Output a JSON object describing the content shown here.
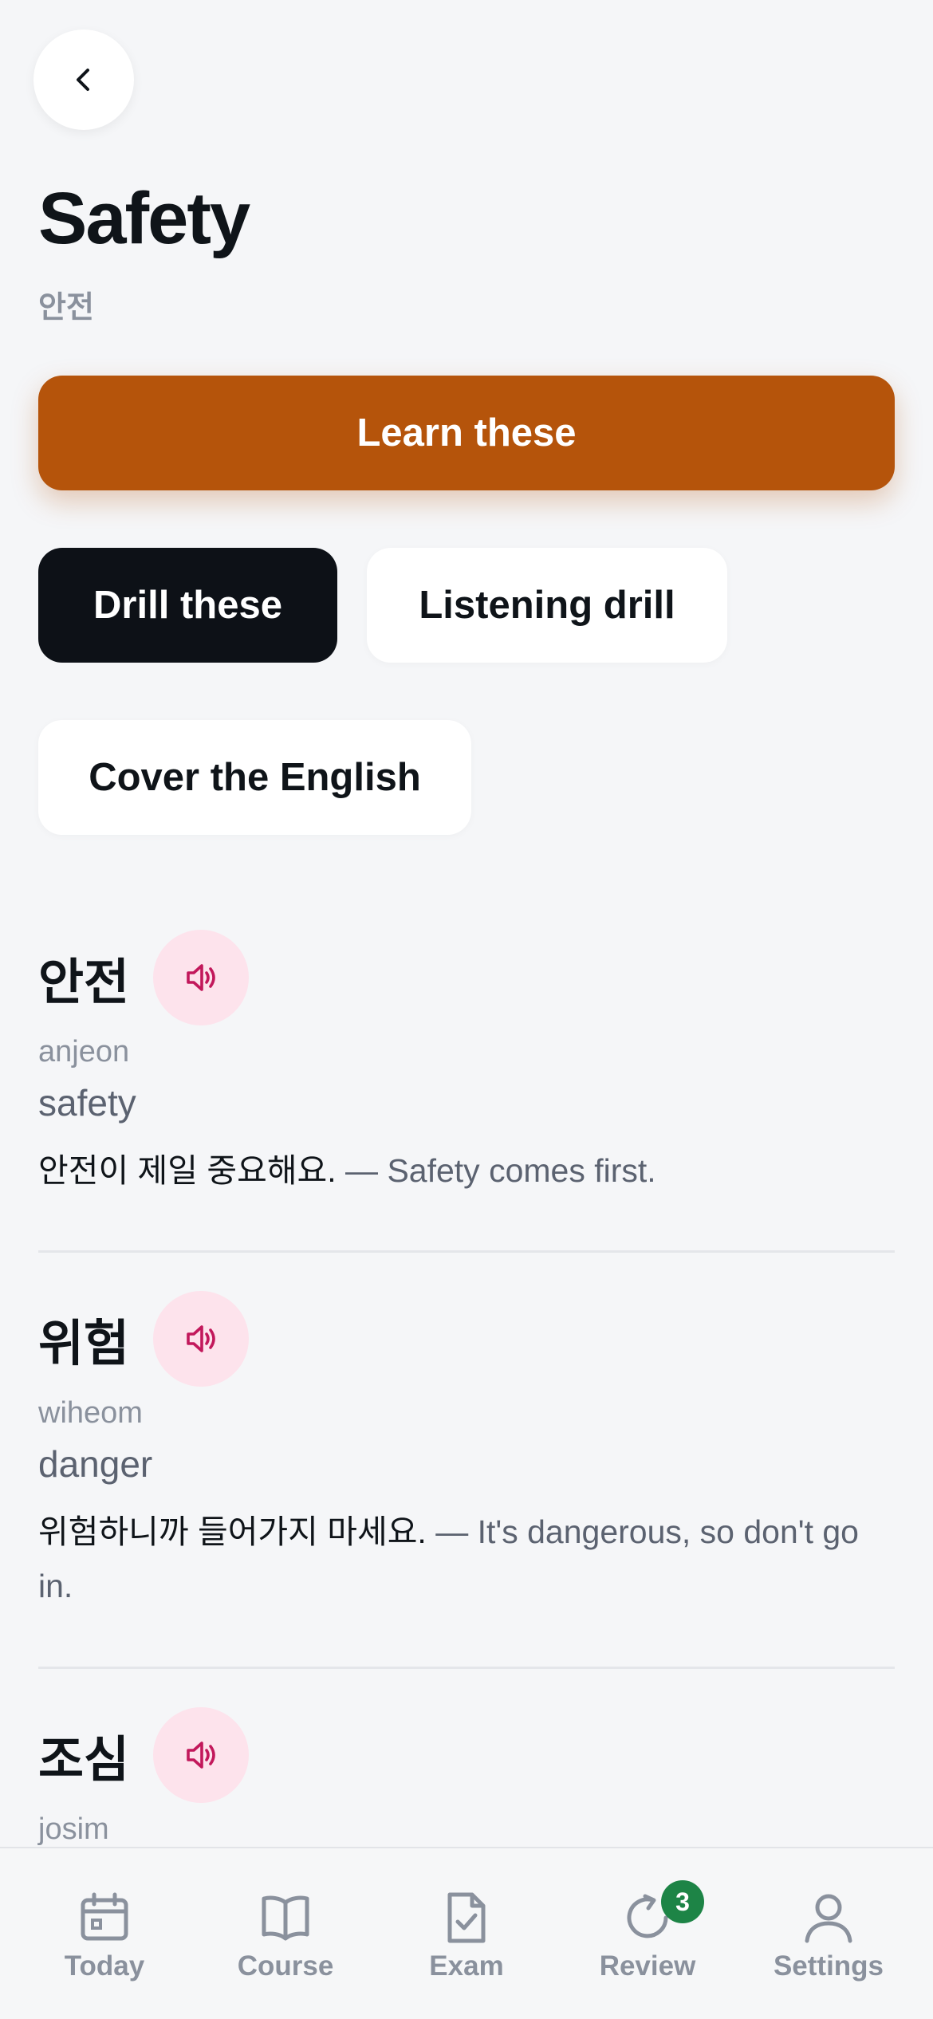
{
  "header": {
    "title": "Safety",
    "subtitle": "안전"
  },
  "actions": {
    "learn": "Learn these",
    "drill": "Drill these",
    "listening": "Listening drill",
    "cover": "Cover the English"
  },
  "words": [
    {
      "korean": "안전",
      "romanization": "anjeon",
      "english": "safety",
      "example_ko": "안전이 제일 중요해요.",
      "example_sep": " — ",
      "example_en": "Safety comes first."
    },
    {
      "korean": "위험",
      "romanization": "wiheom",
      "english": "danger",
      "example_ko": "위험하니까 들어가지 마세요.",
      "example_sep": " — ",
      "example_en": "It's dangerous, so don't go in."
    },
    {
      "korean": "조심",
      "romanization": "josim",
      "english": "",
      "example_ko": "",
      "example_sep": "",
      "example_en": ""
    }
  ],
  "tabs": [
    {
      "label": "Today",
      "icon": "calendar-icon"
    },
    {
      "label": "Course",
      "icon": "book-icon"
    },
    {
      "label": "Exam",
      "icon": "exam-check-icon"
    },
    {
      "label": "Review",
      "icon": "review-refresh-icon",
      "badge": "3"
    },
    {
      "label": "Settings",
      "icon": "person-icon"
    }
  ],
  "colors": {
    "accent": "#b5540b",
    "dark_button": "#0d1117",
    "audio_bg": "#fde3ec",
    "audio_icon": "#c2185b",
    "badge": "#1d8446"
  }
}
